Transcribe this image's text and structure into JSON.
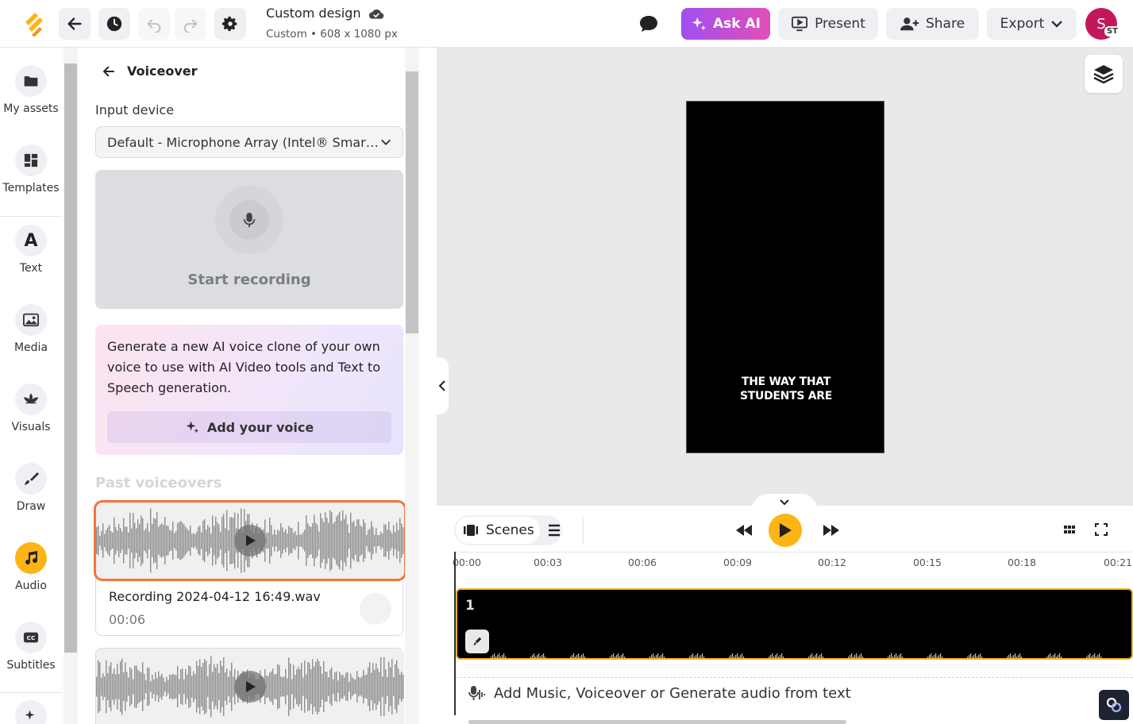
{
  "header": {
    "doc_title": "Custom design",
    "doc_subtitle": "Custom • 608 x 1080 px",
    "ask_ai": "Ask AI",
    "present": "Present",
    "share": "Share",
    "export": "Export",
    "avatar_initial": "S",
    "avatar_badge": "ST"
  },
  "rail": {
    "items": [
      {
        "label": "My assets",
        "icon": "folder-icon"
      },
      {
        "label": "Templates",
        "icon": "templates-icon"
      },
      {
        "label": "Text",
        "icon": "text-icon"
      },
      {
        "label": "Media",
        "icon": "image-icon"
      },
      {
        "label": "Visuals",
        "icon": "visuals-icon"
      },
      {
        "label": "Draw",
        "icon": "brush-icon"
      },
      {
        "label": "Audio",
        "icon": "music-note-icon"
      },
      {
        "label": "Subtitles",
        "icon": "cc-icon"
      }
    ],
    "active": "Audio"
  },
  "panel": {
    "title": "Voiceover",
    "input_device_label": "Input device",
    "input_device_value": "Default - Microphone Array (Intel® Smart Sound Technology)",
    "start_recording": "Start recording",
    "clone_text": "Generate a new AI voice clone of your own voice to use with AI Video tools and Text to Speech generation.",
    "add_voice": "Add your voice",
    "past_title": "Past voiceovers",
    "voiceovers": [
      {
        "name": "Recording 2024-04-12 16:49.wav",
        "duration": "00:06"
      }
    ]
  },
  "canvas": {
    "caption_line1": "THE WAY THAT",
    "caption_line2": "STUDENTS ARE"
  },
  "timeline": {
    "scenes_label": "Scenes",
    "ticks": [
      "00:00",
      "00:03",
      "00:06",
      "00:09",
      "00:12",
      "00:15",
      "00:18",
      "00:21"
    ],
    "scene_number": "1",
    "audio_prompt": "Add Music, Voiceover or Generate audio from text"
  },
  "colors": {
    "accent_yellow": "#fdb515",
    "ask_ai_gradient_start": "#a04ff0",
    "ask_ai_gradient_end": "#e24fb7",
    "selected_outline": "#f4743b"
  }
}
